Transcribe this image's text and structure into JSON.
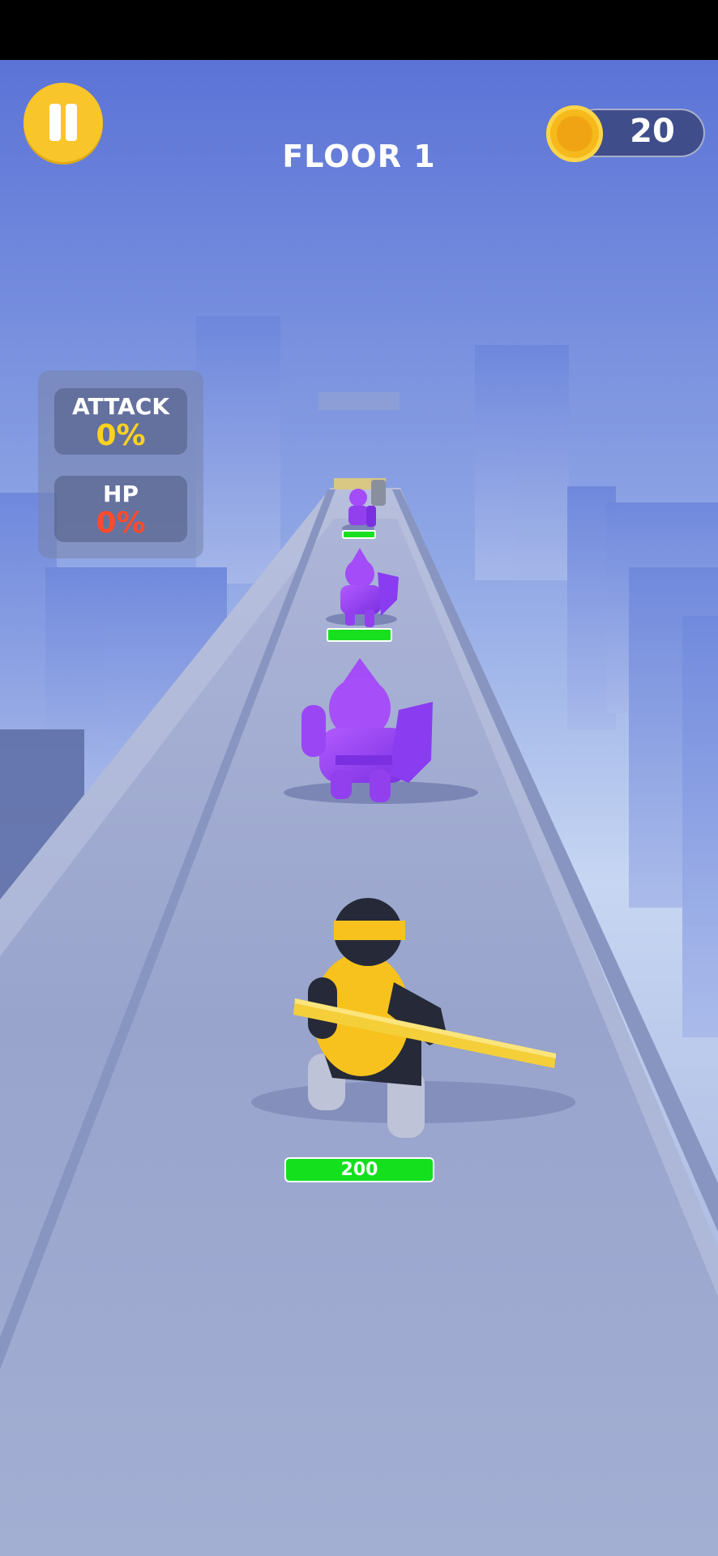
{
  "hud": {
    "floor_title": "FLOOR 1",
    "coins": "20",
    "pause_icon": "pause-icon",
    "coin_icon": "crown-coin-icon"
  },
  "stats": {
    "attack_label": "ATTACK",
    "attack_value": "0%",
    "hp_label": "HP",
    "hp_value": "0%"
  },
  "player": {
    "hp": "200"
  },
  "enemies": [
    {
      "name": "purple-knight-far",
      "health": 1.0
    },
    {
      "name": "purple-knight-mid",
      "health": 1.0
    },
    {
      "name": "purple-knight-near",
      "health": 1.0
    }
  ],
  "colors": {
    "accent_yellow": "#f8c52a",
    "hp_green": "#14e01e",
    "attack_value": "#ffd21f",
    "hp_value": "#ff4b2b",
    "enemy_purple": "#9b3ff2",
    "player_shirt": "#f7c21d"
  }
}
